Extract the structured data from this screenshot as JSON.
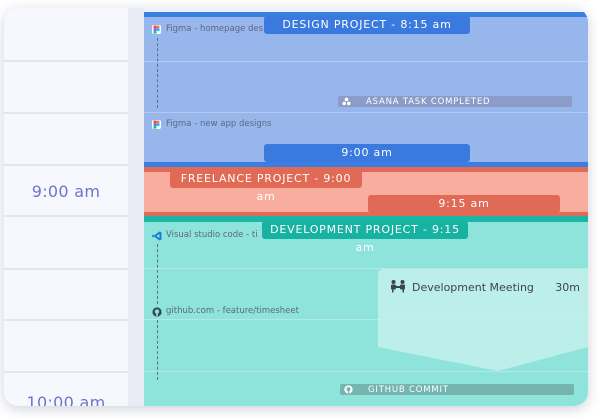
{
  "time_column": {
    "labels": [
      "9:00 am",
      "10:00 am"
    ]
  },
  "colors": {
    "design": "#97b6ec",
    "design_accent": "#3b7de0",
    "freelance": "#f9ad9f",
    "freelance_accent": "#e06a55",
    "development": "#8ee3da",
    "development_accent": "#19b7a6"
  },
  "projects": {
    "design": {
      "label": "DESIGN PROJECT - 8:15 am",
      "end_label": "9:00 am"
    },
    "freelance": {
      "label": "FREELANCE PROJECT - 9:00 am",
      "end_label": "9:15 am"
    },
    "development": {
      "label": "DEVELOPMENT PROJECT - 9:15 am"
    }
  },
  "activities": [
    {
      "icon": "figma-icon",
      "text": "Figma - homepage des"
    },
    {
      "icon": "figma-icon",
      "text": "Figma - new app designs"
    },
    {
      "icon": "vscode-icon",
      "text": "Visual studio code - ti"
    },
    {
      "icon": "github-icon",
      "text": "github.com - feature/timesheet"
    }
  ],
  "tasks": [
    {
      "icon": "asana-icon",
      "label": "ASANA TASK COMPLETED"
    },
    {
      "icon": "github-icon",
      "label": "GITHUB COMMIT"
    }
  ],
  "meeting": {
    "title": "Development Meeting",
    "duration": "30m",
    "icon": "meeting-icon"
  }
}
